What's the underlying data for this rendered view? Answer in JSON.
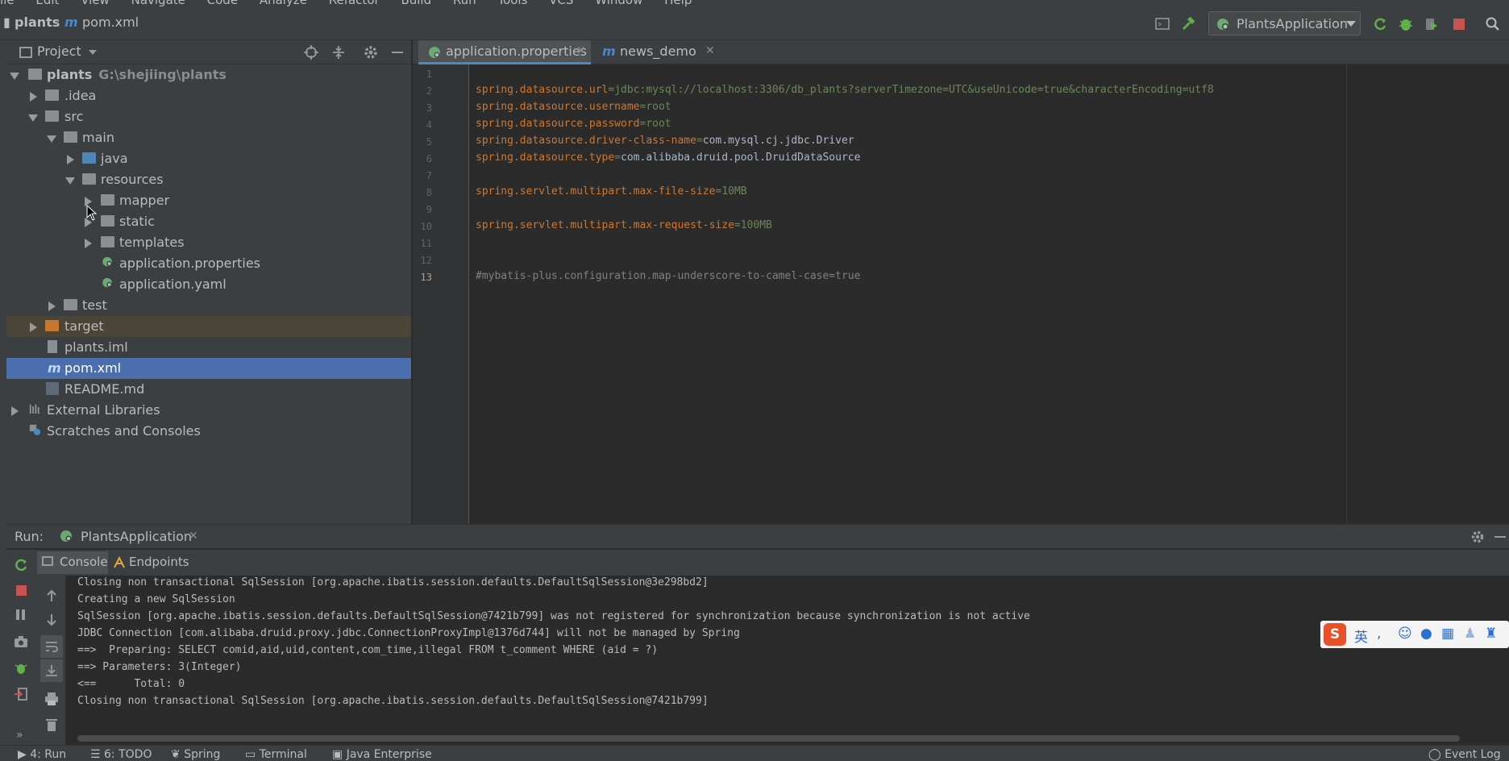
{
  "menu": [
    "ile",
    "Edit",
    "View",
    "Navigate",
    "Code",
    "Analyze",
    "Refactor",
    "Build",
    "Run",
    "Tools",
    "VCS",
    "Window",
    "Help"
  ],
  "breadcrumb": {
    "project": "plants",
    "file": "pom.xml"
  },
  "run_config": {
    "label": "PlantsApplication"
  },
  "project_panel": {
    "title": "Project",
    "tree": [
      {
        "label": "plants",
        "sub": "G:\\shejiing\\plants"
      },
      {
        "label": ".idea"
      },
      {
        "label": "src"
      },
      {
        "label": "main"
      },
      {
        "label": "java"
      },
      {
        "label": "resources"
      },
      {
        "label": "mapper"
      },
      {
        "label": "static"
      },
      {
        "label": "templates"
      },
      {
        "label": "application.properties"
      },
      {
        "label": "application.yaml"
      },
      {
        "label": "test"
      },
      {
        "label": "target"
      },
      {
        "label": "plants.iml"
      },
      {
        "label": "pom.xml"
      },
      {
        "label": "README.md"
      },
      {
        "label": "External Libraries"
      },
      {
        "label": "Scratches and Consoles"
      }
    ]
  },
  "editor": {
    "tabs": [
      {
        "label": "application.properties",
        "active": true
      },
      {
        "label": "news_demo",
        "active": false
      }
    ],
    "line_numbers": [
      "1",
      "2",
      "3",
      "4",
      "5",
      "6",
      "7",
      "8",
      "9",
      "10",
      "11",
      "12",
      "13"
    ],
    "lines": [
      {
        "key": "",
        "eq": "",
        "val": "",
        "comment": ""
      },
      {
        "key": "spring.datasource.url",
        "eq": "=",
        "val": "jdbc:mysql://localhost:3306/db_plants?serverTimezone=UTC&useUnicode=true&characterEncoding=utf8",
        "comment": ""
      },
      {
        "key": "spring.datasource.username",
        "eq": "=",
        "val": "root",
        "comment": ""
      },
      {
        "key": "spring.datasource.password",
        "eq": "=",
        "val": "root",
        "comment": ""
      },
      {
        "key": "spring.datasource.driver-class-name",
        "eq": "=",
        "val": "com.mysql.cj.jdbc.Driver",
        "comment": ""
      },
      {
        "key": "spring.datasource.type",
        "eq": "=",
        "val": "com.alibaba.druid.pool.DruidDataSource",
        "comment": ""
      },
      {
        "key": "",
        "eq": "",
        "val": "",
        "comment": ""
      },
      {
        "key": "spring.servlet.multipart.max-file-size",
        "eq": "=",
        "val": "10MB",
        "comment": ""
      },
      {
        "key": "",
        "eq": "",
        "val": "",
        "comment": ""
      },
      {
        "key": "spring.servlet.multipart.max-request-size",
        "eq": "=",
        "val": "100MB",
        "comment": ""
      },
      {
        "key": "",
        "eq": "",
        "val": "",
        "comment": ""
      },
      {
        "key": "",
        "eq": "",
        "val": "",
        "comment": ""
      },
      {
        "key": "",
        "eq": "",
        "val": "",
        "comment": "#mybatis-plus.configuration.map-underscore-to-camel-case=true"
      }
    ]
  },
  "run_panel": {
    "label": "Run:",
    "tab": "PlantsApplication",
    "subtabs": [
      "Console",
      "Endpoints"
    ],
    "console": [
      "Closing non transactional SqlSession [org.apache.ibatis.session.defaults.DefaultSqlSession@3e298bd2]",
      "Creating a new SqlSession",
      "SqlSession [org.apache.ibatis.session.defaults.DefaultSqlSession@7421b799] was not registered for synchronization because synchronization is not active",
      "JDBC Connection [com.alibaba.druid.proxy.jdbc.ConnectionProxyImpl@1376d744] will not be managed by Spring",
      "==>  Preparing: SELECT comid,aid,uid,content,com_time,illegal FROM t_comment WHERE (aid = ?)",
      "==> Parameters: 3(Integer)",
      "<==      Total: 0",
      "Closing non transactional SqlSession [org.apache.ibatis.session.defaults.DefaultSqlSession@7421b799]"
    ]
  },
  "status_bar": {
    "items": [
      "4: Run",
      "6: TODO",
      "Spring",
      "Terminal",
      "Java Enterprise"
    ],
    "event_log": "Event Log"
  },
  "ime": {
    "lang": "英"
  }
}
